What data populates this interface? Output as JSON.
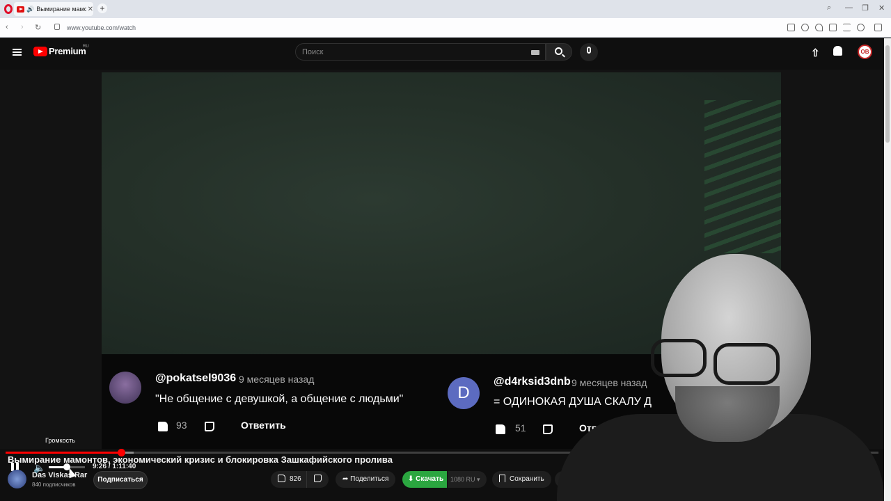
{
  "browser": {
    "tab_title": "Вымирание мамонто",
    "tab_audio": "🔊",
    "tab_close": "✕",
    "new_tab": "+",
    "url": "www.youtube.com/watch"
  },
  "header": {
    "brand": "Premium",
    "region": "RU",
    "search_placeholder": "Поиск",
    "avatar_initials": "OB"
  },
  "comments": [
    {
      "user": "@pokatsel9036",
      "time": "9 месяцев назад",
      "text": "\"Не общение с девушкой, а общение с людьми\"",
      "likes": "93",
      "reply": "Ответить"
    },
    {
      "avatar_letter": "D",
      "user": "@d4rksid3dnb",
      "time": "9 месяцев назад",
      "text": "= ОДИНОКАЯ ДУША СКАЛУ Д",
      "likes": "51",
      "reply": "Ответить"
    }
  ],
  "player": {
    "tooltip": "Громкость",
    "time_display": "9:26 / 1:11:40",
    "progress_fraction": 0.132,
    "buffer_fraction": 0.147,
    "volume_fraction": 0.5
  },
  "video": {
    "title": "Вымирание мамонтов, экономический кризис и блокировка Зашкафийского пролива",
    "channel_name": "Das Viskas Rar",
    "subscribers": "840 подписчиков",
    "subscribe_label": "Подписаться",
    "likes": "826",
    "share_label": "Поделиться",
    "download_label": "Скачать",
    "quality_label": "1080 RU",
    "save_label": "Сохранить"
  },
  "colors": {
    "accent_red": "#ff0000",
    "download_green": "#2ba640"
  }
}
